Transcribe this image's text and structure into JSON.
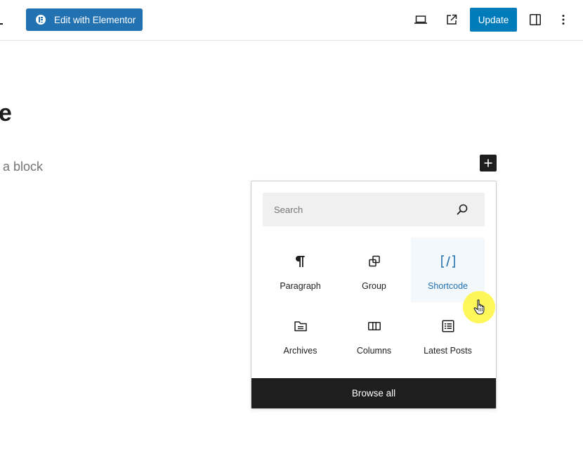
{
  "toolbar": {
    "elementor_button_label": "Edit with Elementor",
    "update_button_label": "Update",
    "icons": {
      "preview": "laptop-icon",
      "view_post": "external-link-icon",
      "settings_sidebar": "sidebar-toggle-icon",
      "options": "more-vertical-icon"
    },
    "accent_color": "#007cba",
    "elementor_color": "#2271b1"
  },
  "canvas": {
    "title_fragment": "e",
    "block_prompt": "a block"
  },
  "inserter": {
    "toggle_icon": "plus-icon",
    "search": {
      "placeholder": "Search",
      "value": ""
    },
    "blocks": [
      {
        "label": "Paragraph",
        "icon": "paragraph-icon"
      },
      {
        "label": "Group",
        "icon": "group-icon"
      },
      {
        "label": "Shortcode",
        "icon": "shortcode-icon",
        "hovered": true
      },
      {
        "label": "Archives",
        "icon": "archives-icon"
      },
      {
        "label": "Columns",
        "icon": "columns-icon"
      },
      {
        "label": "Latest Posts",
        "icon": "latest-posts-icon"
      }
    ],
    "browse_all_label": "Browse all"
  }
}
